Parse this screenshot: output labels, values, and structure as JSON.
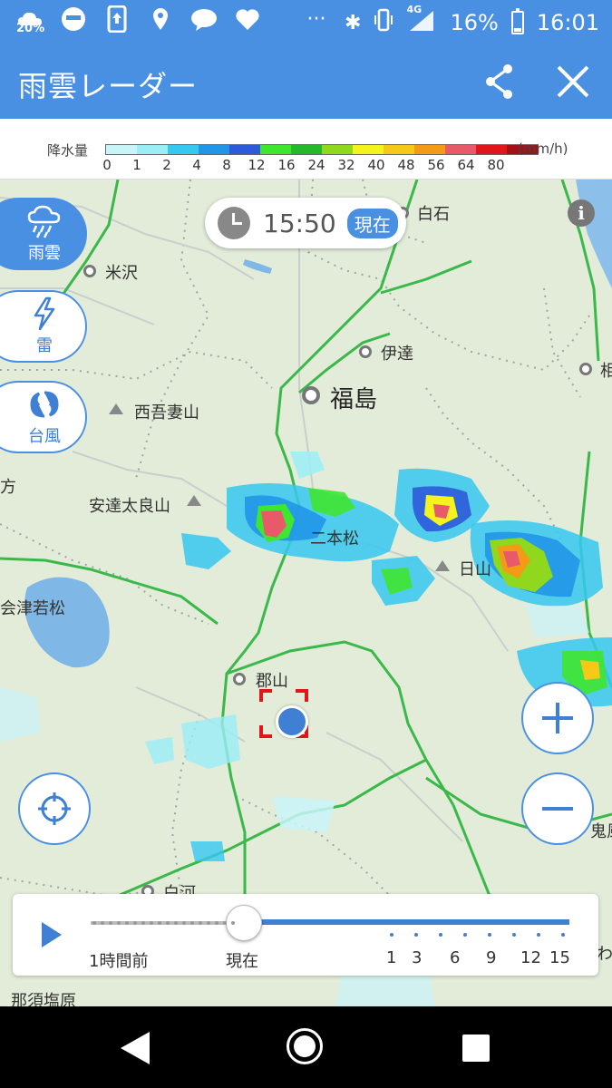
{
  "status_bar": {
    "weather_percent": "20%",
    "network": "4G",
    "battery": "16%",
    "battery_level": 0.16,
    "time": "16:01",
    "overflow": "···"
  },
  "app_bar": {
    "title": "雨雲レーダー",
    "share_icon": "share-icon",
    "close_icon": "close-icon"
  },
  "legend": {
    "label": "降水量",
    "unit": "(mm/h)",
    "colors": [
      "#c9f4f8",
      "#9aeef6",
      "#36c8f0",
      "#2196e6",
      "#2c5ad8",
      "#3ee62f",
      "#25b82a",
      "#8fd81d",
      "#f5f31d",
      "#f6c918",
      "#f39b17",
      "#e85a6a",
      "#e0161b",
      "#a01218"
    ],
    "ticks": [
      "0",
      "1",
      "2",
      "4",
      "8",
      "12",
      "16",
      "24",
      "32",
      "40",
      "48",
      "56",
      "64",
      "80"
    ]
  },
  "side_menu": [
    {
      "label": "雨雲",
      "icon": "rain-cloud-icon",
      "active": true
    },
    {
      "label": "雷",
      "icon": "lightning-icon",
      "active": false
    },
    {
      "label": "台風",
      "icon": "typhoon-icon",
      "active": false
    }
  ],
  "time_pill": {
    "time": "15:50",
    "badge": "現在"
  },
  "map_labels": {
    "shiroishi": "白石",
    "yonezawa": "米沢",
    "date": "伊達",
    "fukushima": "福島",
    "nishiazuma": "西吾妻山",
    "adatara": "安達太良山",
    "nihonmatsu": "二本松",
    "aizuwakamatsu": "会津若松",
    "koriyama": "郡山",
    "shirakawa": "白河",
    "nasushiobara": "那須塩原",
    "hiyama": "日山",
    "edge_left": "方",
    "edge_right_top": "相",
    "edge_right_mid": "鬼風",
    "edge_right_bot": "いわ"
  },
  "timeline": {
    "past_label": "1時間前",
    "now_label": "現在",
    "future_labels": [
      "1",
      "3",
      "6",
      "9",
      "12",
      "15"
    ]
  }
}
